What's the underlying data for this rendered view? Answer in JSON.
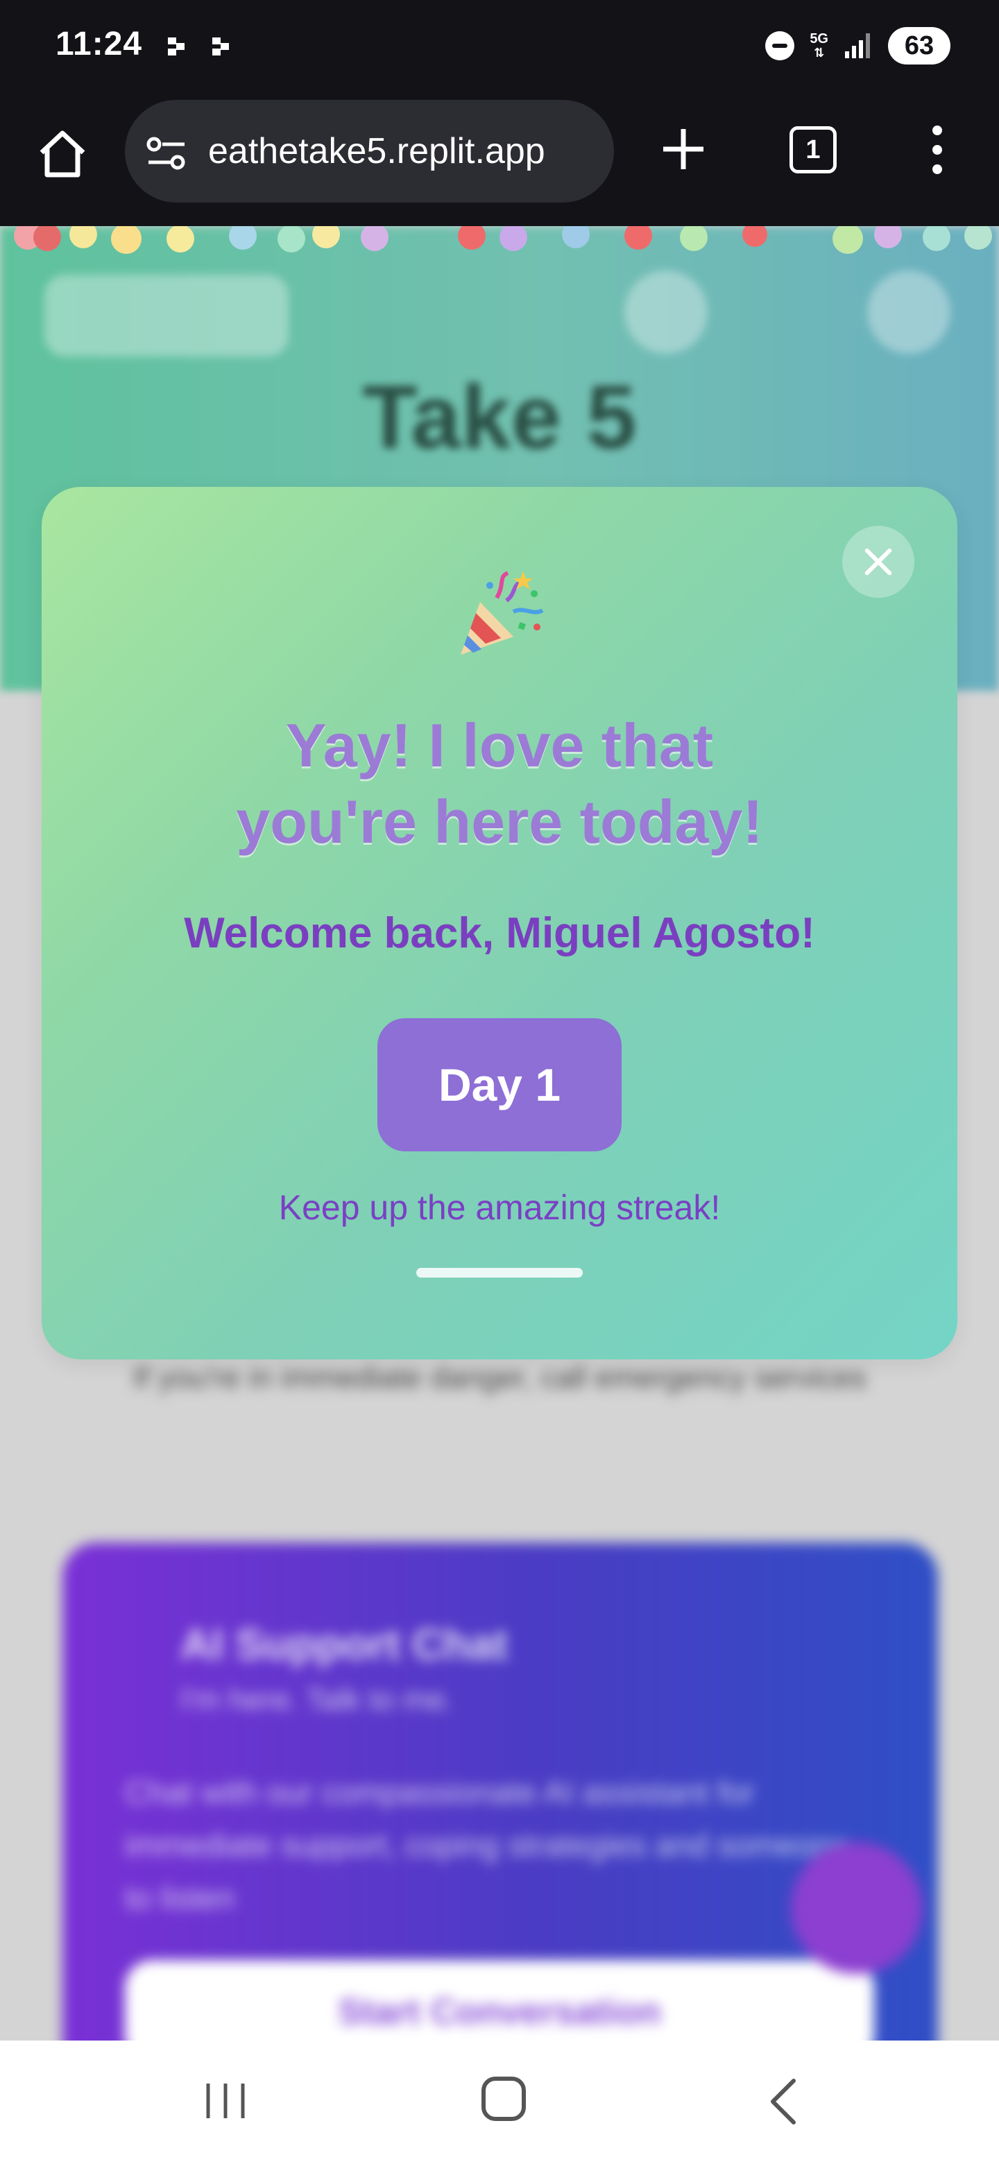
{
  "status_bar": {
    "time": "11:24",
    "network": "5G",
    "battery": "63",
    "icons": [
      "notification-icon",
      "notification-icon",
      "do-not-disturb-icon",
      "data-arrows-icon",
      "signal-icon"
    ]
  },
  "browser": {
    "url": "eathetake5.replit.app",
    "tab_count": "1",
    "icons": [
      "home-icon",
      "site-settings-icon",
      "plus-icon",
      "tabs-icon",
      "more-vert-icon"
    ]
  },
  "background_page": {
    "title": "Take 5",
    "emergency_note": "If you're in immediate danger, call emergency services",
    "chat_card": {
      "title": "AI Support Chat",
      "subtitle": "I'm here. Talk to me.",
      "description": "Chat with our compassionate AI assistant for immediate support, coping strategies and someone to listen",
      "button_label": "Start Conversation"
    }
  },
  "modal": {
    "emoji": "🎉",
    "title_line1": "Yay! I love that",
    "title_line2": "you're here today!",
    "welcome": "Welcome back, Miguel Agosto!",
    "day_label": "Day 1",
    "streak_message": "Keep up the amazing streak!",
    "colors": {
      "title": "#9b7bd6",
      "welcome": "#7a3fc0",
      "badge": "#8d6fd6",
      "gradient_start": "#a9e6a0",
      "gradient_end": "#74d4c6"
    }
  },
  "nav_bar": {
    "icons": [
      "recents-icon",
      "home-icon",
      "back-icon"
    ]
  }
}
